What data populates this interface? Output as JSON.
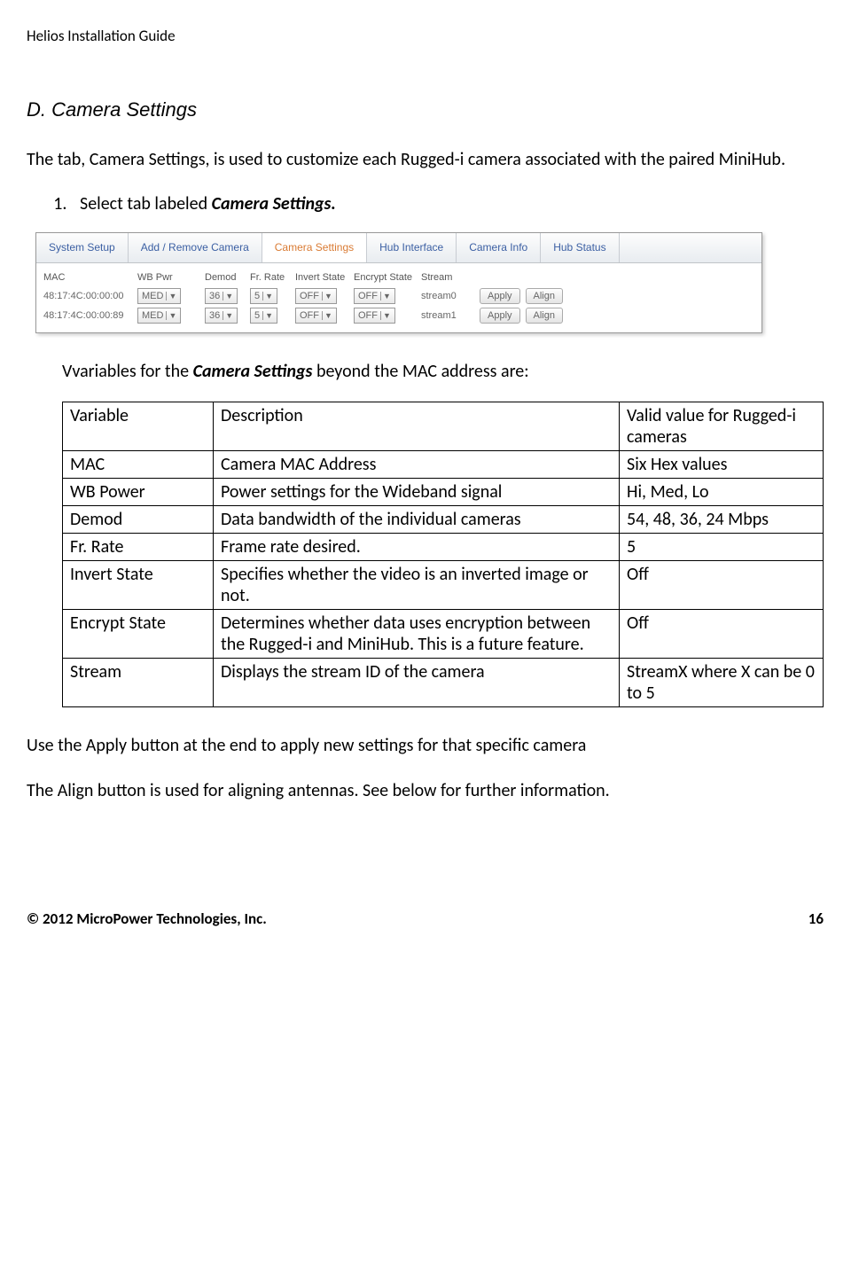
{
  "header": "Helios Installation Guide",
  "section": {
    "label": "D.  Camera Settings"
  },
  "intro": "The  tab, Camera Settings, is used to customize each Rugged-i camera associated with the paired MiniHub.",
  "step1_prefix": "Select tab labeled ",
  "step1_bold": "Camera Settings.",
  "tabs": [
    "System Setup",
    "Add / Remove Camera",
    "Camera Settings",
    "Hub Interface",
    "Camera Info",
    "Hub Status"
  ],
  "settings_headers": [
    "MAC",
    "WB Pwr",
    "Demod",
    "Fr. Rate",
    "Invert State",
    "Encrypt State",
    "Stream"
  ],
  "settings_rows": [
    {
      "mac": "48:17:4C:00:00:00",
      "wb": "MED",
      "demod": "36",
      "fr": "5",
      "inv": "OFF",
      "enc": "OFF",
      "stream": "stream0",
      "apply": "Apply",
      "align": "Align"
    },
    {
      "mac": "48:17:4C:00:00:89",
      "wb": "MED",
      "demod": "36",
      "fr": "5",
      "inv": "OFF",
      "enc": "OFF",
      "stream": "stream1",
      "apply": "Apply",
      "align": "Align"
    }
  ],
  "vars_intro_prefix": "Vvariables for the ",
  "vars_intro_bold": "Camera Settings",
  "vars_intro_suffix": "  beyond the MAC address are:",
  "vars_header": {
    "c1": "Variable",
    "c2": "Description",
    "c3": "Valid value for Rugged-i cameras"
  },
  "vars_rows": [
    {
      "c1": "MAC",
      "c2": "Camera MAC Address",
      "c3": "Six Hex values"
    },
    {
      "c1": "WB Power",
      "c2": "Power settings for the Wideband signal",
      "c3": "Hi, Med, Lo"
    },
    {
      "c1": "Demod",
      "c2": "Data bandwidth of the individual cameras",
      "c3": "54, 48, 36, 24 Mbps"
    },
    {
      "c1": "Fr. Rate",
      "c2": "Frame rate desired.",
      "c3": "5"
    },
    {
      "c1": "Invert State",
      "c2": "Specifies whether the video is an inverted image or not.",
      "c3": "Off"
    },
    {
      "c1": "Encrypt State",
      "c2": "Determines whether data uses encryption between the Rugged-i and MiniHub. This is a future feature.",
      "c3": "Off"
    },
    {
      "c1": "Stream",
      "c2": "Displays the stream ID of the camera",
      "c3": "StreamX where X can be 0 to 5"
    }
  ],
  "after1": "Use the Apply button at the end to apply new settings for that specific camera",
  "after2": "The Align button is used for aligning antennas.  See below for further information.",
  "footer": {
    "left": "© 2012 MicroPower Technologies, Inc.",
    "right": "16"
  }
}
